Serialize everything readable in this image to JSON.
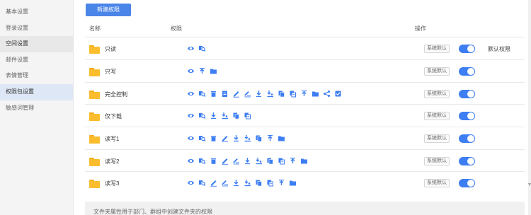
{
  "sidebar": {
    "items": [
      {
        "label": "基本设置"
      },
      {
        "label": "登录设置"
      },
      {
        "label": "空间设置"
      },
      {
        "label": "邮件设置"
      },
      {
        "label": "表情管理"
      },
      {
        "label": "权限包设置"
      },
      {
        "label": "敏感词管理"
      }
    ]
  },
  "toolbar": {
    "new_button_label": "新建权限"
  },
  "table": {
    "headers": {
      "name": "名称",
      "permissions": "权限",
      "actions": "操作"
    },
    "rows": [
      {
        "name": "只读",
        "badge": "系统默认",
        "enabled": true,
        "default_label": "默认权限",
        "icons": [
          "eye-icon",
          "search-icon"
        ]
      },
      {
        "name": "只写",
        "badge": "系统默认",
        "enabled": true,
        "icons": [
          "eye-icon",
          "upload-icon",
          "folder-icon"
        ]
      },
      {
        "name": "完全控制",
        "badge": "系统默认",
        "enabled": true,
        "icons": [
          "eye-icon",
          "search-icon",
          "delete-icon",
          "clipboard-icon",
          "edit-icon",
          "edit-list-icon",
          "download-icon",
          "download-user-icon",
          "copy-icon",
          "move-icon",
          "upload-icon",
          "folder-icon",
          "share-icon",
          "checkbox-icon"
        ]
      },
      {
        "name": "仅下载",
        "badge": "系统默认",
        "enabled": true,
        "icons": [
          "eye-icon",
          "search-icon",
          "download-icon",
          "download-user-icon",
          "copy-icon",
          "move-icon"
        ]
      },
      {
        "name": "读写1",
        "badge": "系统默认",
        "enabled": true,
        "icons": [
          "eye-icon",
          "search-icon",
          "delete-icon",
          "edit-icon",
          "download-icon",
          "download-user-icon",
          "copy-icon",
          "upload-icon",
          "folder-icon"
        ]
      },
      {
        "name": "读写2",
        "badge": "系统默认",
        "enabled": true,
        "icons": [
          "eye-icon",
          "search-icon",
          "delete-icon",
          "edit-icon",
          "edit-list-icon",
          "download-icon",
          "download-user-icon",
          "copy-icon",
          "move-icon",
          "upload-icon",
          "folder-icon"
        ]
      },
      {
        "name": "读写3",
        "badge": "系统默认",
        "enabled": true,
        "icons": [
          "eye-icon",
          "search-icon",
          "edit-icon",
          "edit-list-icon",
          "download-icon",
          "download-user-icon",
          "copy-icon",
          "move-icon",
          "upload-icon",
          "folder-icon"
        ]
      }
    ]
  },
  "footer": {
    "note": "文件夹属性用于部门、群组中创建文件夹的权限"
  },
  "colors": {
    "accent": "#4a85e8",
    "icon": "#3d7ef2",
    "folder": "#fbbd2e"
  }
}
